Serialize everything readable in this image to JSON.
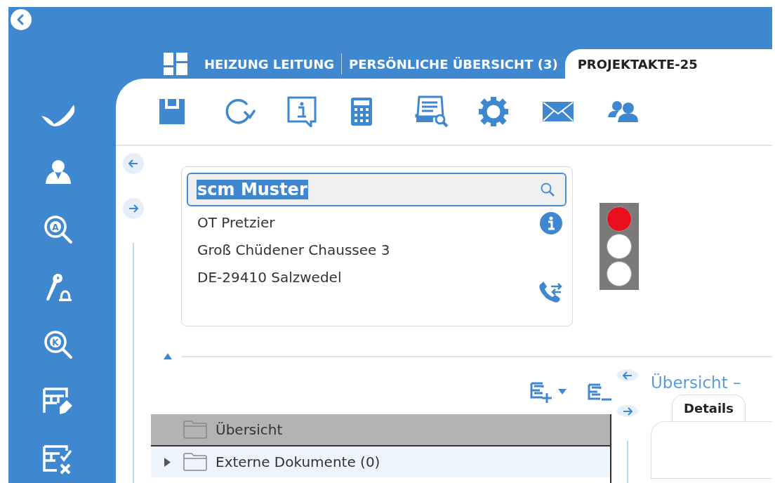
{
  "tabs": [
    {
      "label": "HEIZUNG LEITUNG",
      "kind": "home",
      "selected": false
    },
    {
      "label": "PERSÖNLICHE ÜBERSICHT (3)",
      "kind": "plain",
      "selected": false
    },
    {
      "label": "PROJEKTAKTE-25",
      "kind": "plain",
      "selected": true
    }
  ],
  "sidebar": {
    "items": [
      {
        "kind": "check"
      },
      {
        "kind": "person"
      },
      {
        "kind": "letter-search",
        "letter": "A"
      },
      {
        "kind": "wrench-bell"
      },
      {
        "kind": "letter-search",
        "letter": "K"
      },
      {
        "kind": "sheet-edit"
      },
      {
        "kind": "sheet-check"
      }
    ]
  },
  "toolbar": {
    "items": [
      {
        "kind": "save"
      },
      {
        "kind": "refresh"
      },
      {
        "kind": "info"
      },
      {
        "kind": "calculator"
      },
      {
        "kind": "doc-search"
      },
      {
        "kind": "gear"
      },
      {
        "kind": "mail"
      },
      {
        "kind": "people"
      }
    ]
  },
  "contact": {
    "name": "scm Muster",
    "name_selected": true,
    "lines": [
      "OT Pretzier",
      "Groß Chüdener Chaussee 3",
      "DE-29410 Salzwedel"
    ]
  },
  "traffic_light": {
    "lamps": [
      {
        "lit": true
      },
      {
        "lit": false
      },
      {
        "lit": false
      }
    ]
  },
  "tree": {
    "rows": [
      {
        "label": "Übersicht",
        "selected": true,
        "expandable": false
      },
      {
        "label": "Externe Dokumente (0)",
        "selected": false,
        "expandable": true
      }
    ]
  },
  "detail_panel": {
    "title": "Übersicht –",
    "tabs": [
      {
        "label": "Details",
        "selected": true
      }
    ]
  }
}
